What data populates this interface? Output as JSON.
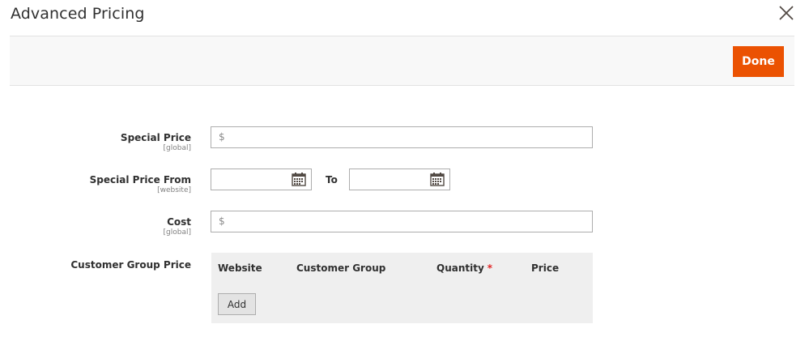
{
  "modal": {
    "title": "Advanced Pricing"
  },
  "icons": {
    "close": "close-icon",
    "calendar": "calendar-icon"
  },
  "actions": {
    "done_label": "Done"
  },
  "colors": {
    "accent": "#eb5202",
    "required": "#e22626",
    "table_bg": "#efefef"
  },
  "fields": {
    "special_price": {
      "label": "Special Price",
      "scope": "[global]",
      "currency": "$",
      "value": ""
    },
    "special_price_from": {
      "label": "Special Price From",
      "scope": "[website]",
      "from_value": "",
      "to_label": "To",
      "to_value": ""
    },
    "cost": {
      "label": "Cost",
      "scope": "[global]",
      "currency": "$",
      "value": ""
    },
    "customer_group_price": {
      "label": "Customer Group Price",
      "columns": {
        "website": "Website",
        "customer_group": "Customer Group",
        "quantity": "Quantity",
        "quantity_required": "*",
        "price": "Price"
      },
      "add_label": "Add"
    }
  }
}
